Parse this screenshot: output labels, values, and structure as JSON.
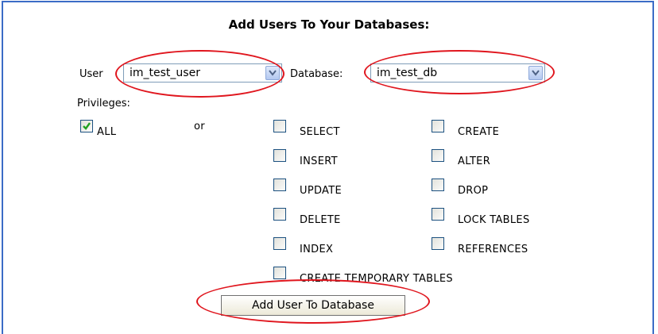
{
  "title": "Add Users To Your Databases:",
  "user": {
    "label": "User",
    "value": "im_test_user"
  },
  "database": {
    "label": "Database:",
    "value": "im_test_db"
  },
  "privileges": {
    "label": "Privileges:",
    "all": {
      "label": "ALL",
      "checked": true
    },
    "or_text": "or",
    "items": [
      {
        "label": "SELECT",
        "checked": false
      },
      {
        "label": "CREATE",
        "checked": false
      },
      {
        "label": "INSERT",
        "checked": false
      },
      {
        "label": "ALTER",
        "checked": false
      },
      {
        "label": "UPDATE",
        "checked": false
      },
      {
        "label": "DROP",
        "checked": false
      },
      {
        "label": "DELETE",
        "checked": false
      },
      {
        "label": "LOCK TABLES",
        "checked": false
      },
      {
        "label": "INDEX",
        "checked": false
      },
      {
        "label": "REFERENCES",
        "checked": false
      },
      {
        "label": "CREATE TEMPORARY TABLES",
        "checked": false
      }
    ]
  },
  "submit_label": "Add User To Database",
  "colors": {
    "frame_border": "#3b6cc6",
    "highlight_oval": "#e0161e",
    "check_mark": "#21a121"
  }
}
